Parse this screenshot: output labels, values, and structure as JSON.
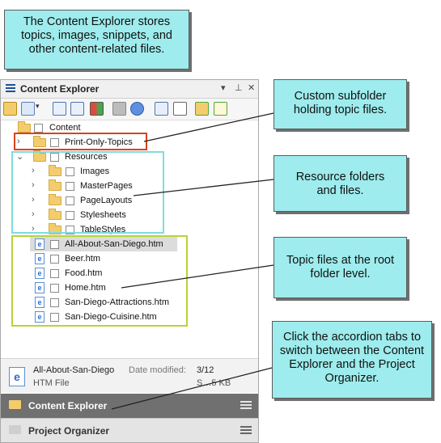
{
  "callouts": {
    "top": "The Content Explorer stores topics, images, snippets, and other content-related files.",
    "custom_subfolder": "Custom subfolder holding topic files.",
    "resources": "Resource folders and files.",
    "topic_files": "Topic files at the root folder level.",
    "accordion": "Click the accordion tabs to switch between the Content Explorer and the Project Organizer."
  },
  "panel": {
    "title": "Content Explorer",
    "title_controls": [
      "▾",
      "ᵖ",
      "✕"
    ]
  },
  "tree": {
    "root": "Content",
    "print_only": "Print-Only-Topics",
    "resources": "Resources",
    "resource_children": [
      "Images",
      "MasterPages",
      "PageLayouts",
      "Stylesheets",
      "TableStyles"
    ],
    "files": [
      "All-About-San-Diego.htm",
      "Beer.htm",
      "Food.htm",
      "Home.htm",
      "San-Diego-Attractions.htm",
      "San-Diego-Cuisine.htm"
    ]
  },
  "details": {
    "name": "All-About-San-Diego",
    "date_label": "Date modified:",
    "date_value": "3/12",
    "type": "HTM File",
    "size": "S…5 KB"
  },
  "accordion": {
    "tab1": "Content Explorer",
    "tab2": "Project Organizer"
  },
  "colors": {
    "callout_fill": "#9eeced",
    "red_box": "#d9421f",
    "cyan_box": "#7fdcdc",
    "green_box": "#b8d33b"
  },
  "icons": [
    "menu-icon",
    "folder-icon",
    "file-htm-icon",
    "checkbox-icon",
    "chevron-right-icon",
    "chevron-down-icon",
    "hamburger-icon"
  ]
}
